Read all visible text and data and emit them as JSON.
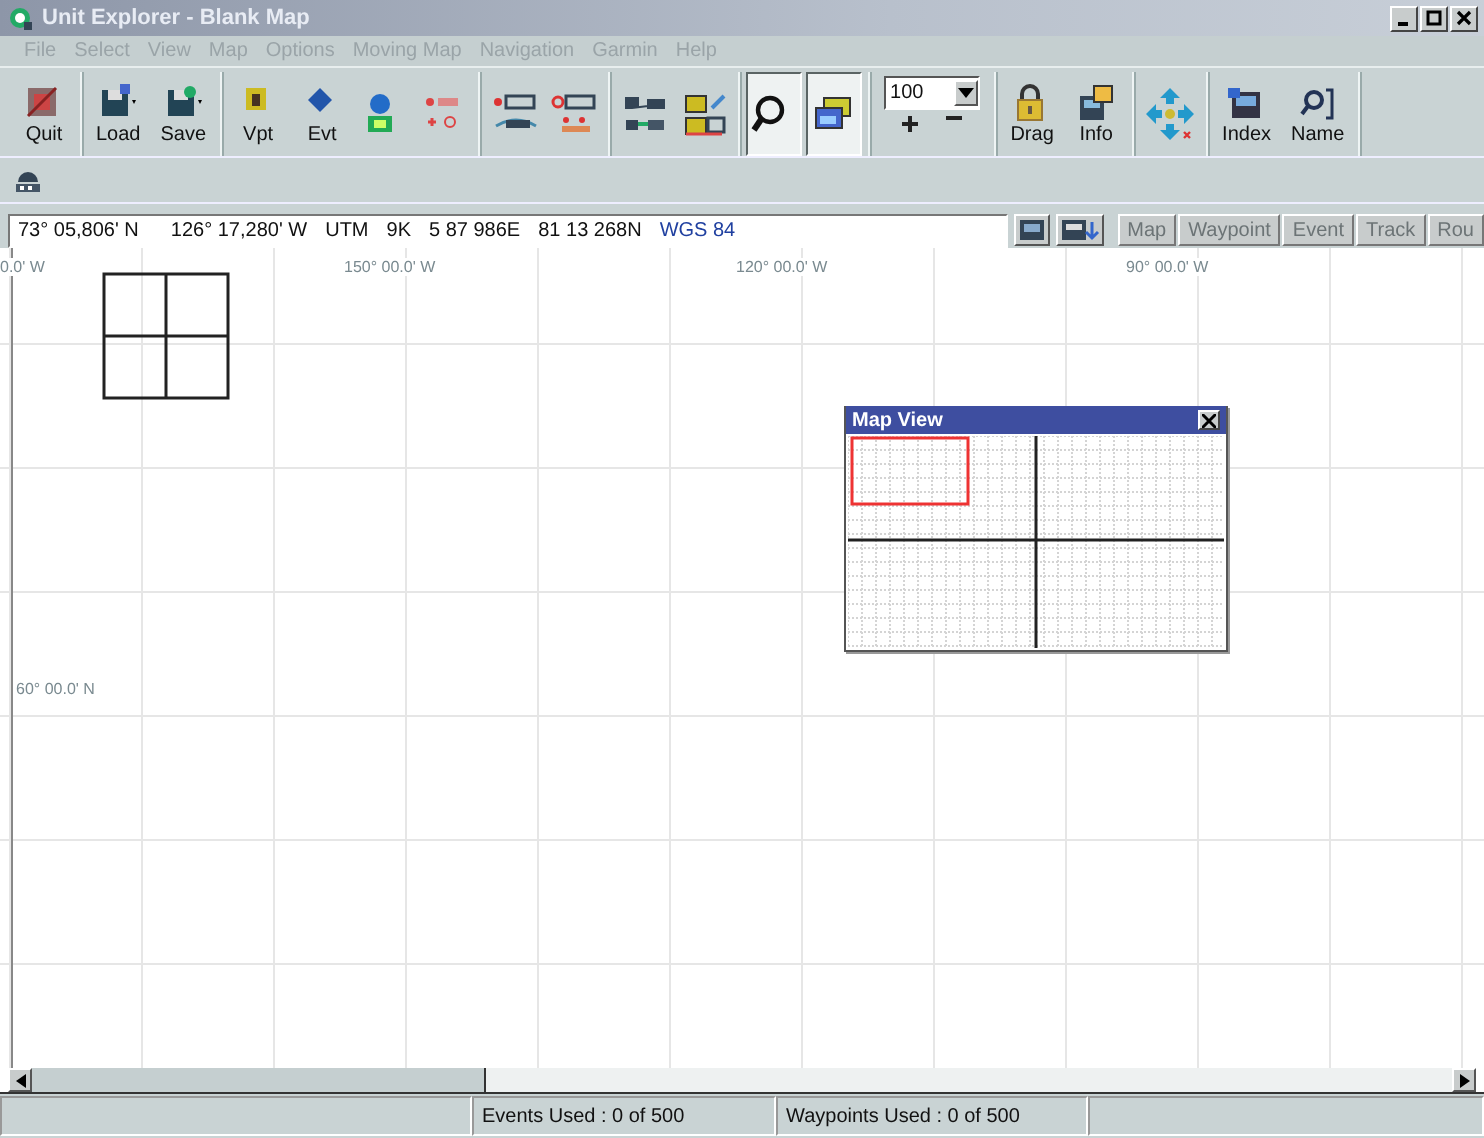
{
  "window": {
    "title": "Unit Explorer - Blank Map"
  },
  "menu": [
    "File",
    "Select",
    "View",
    "Map",
    "Options",
    "Moving Map",
    "Navigation",
    "Garmin",
    "Help"
  ],
  "toolbar": [
    {
      "buttons": [
        {
          "kind": "labeled",
          "label": "Quit",
          "pressed": false
        }
      ]
    },
    {
      "buttons": [
        {
          "kind": "labeled",
          "label": "Load",
          "pressed": false
        },
        {
          "kind": "labeled",
          "label": "Save",
          "pressed": false
        }
      ]
    },
    {
      "buttons": [
        {
          "kind": "labeled",
          "label": "Vpt",
          "pressed": false
        },
        {
          "kind": "labeled",
          "label": "Evt",
          "pressed": false
        },
        {
          "kind": "icon",
          "pressed": false
        },
        {
          "kind": "icon",
          "pressed": false
        }
      ]
    },
    {
      "buttons": [
        {
          "kind": "icon",
          "pressed": false
        },
        {
          "kind": "icon",
          "pressed": false
        }
      ]
    },
    {
      "buttons": [
        {
          "kind": "icon",
          "pressed": false
        },
        {
          "kind": "icon",
          "pressed": false
        }
      ]
    },
    {
      "buttons": [
        {
          "kind": "icon",
          "pressed": true
        },
        {
          "kind": "icon",
          "pressed": true
        }
      ]
    },
    {
      "buttons": [
        {
          "kind": "zoom",
          "value": "100"
        }
      ]
    },
    {
      "buttons": [
        {
          "kind": "labeled",
          "label": "Drag",
          "pressed": false
        },
        {
          "kind": "labeled",
          "label": "Info",
          "pressed": false
        }
      ]
    },
    {
      "buttons": [
        {
          "kind": "icon",
          "pressed": false
        }
      ]
    },
    {
      "buttons": [
        {
          "kind": "labeled",
          "label": "Index",
          "pressed": false
        },
        {
          "kind": "labeled",
          "label": "Name",
          "pressed": false
        }
      ]
    }
  ],
  "coordinates": {
    "latitude": "73° 05,806' N",
    "longitude": "126° 17,280' W",
    "grid": "UTM",
    "zone": "9K",
    "easting": "5 87 986E",
    "northing": "81 13 268N",
    "datum": "WGS 84"
  },
  "tabs": [
    {
      "label": "Map",
      "disabled": true
    },
    {
      "label": "Waypoint",
      "disabled": true
    },
    {
      "label": "Event",
      "disabled": true
    },
    {
      "label": "Track",
      "disabled": true
    },
    {
      "label": "Rou",
      "disabled": true
    }
  ],
  "map": {
    "labels": [
      "0.0' W",
      "150° 00.0' W",
      "120° 00.0' W",
      "90° 00.0' W",
      "60° 00.0' N"
    ],
    "map_view": {
      "title": "Map View"
    }
  },
  "status_bar": [
    "Events Used : 0 of 500",
    "Waypoints Used : 0 of 500"
  ]
}
